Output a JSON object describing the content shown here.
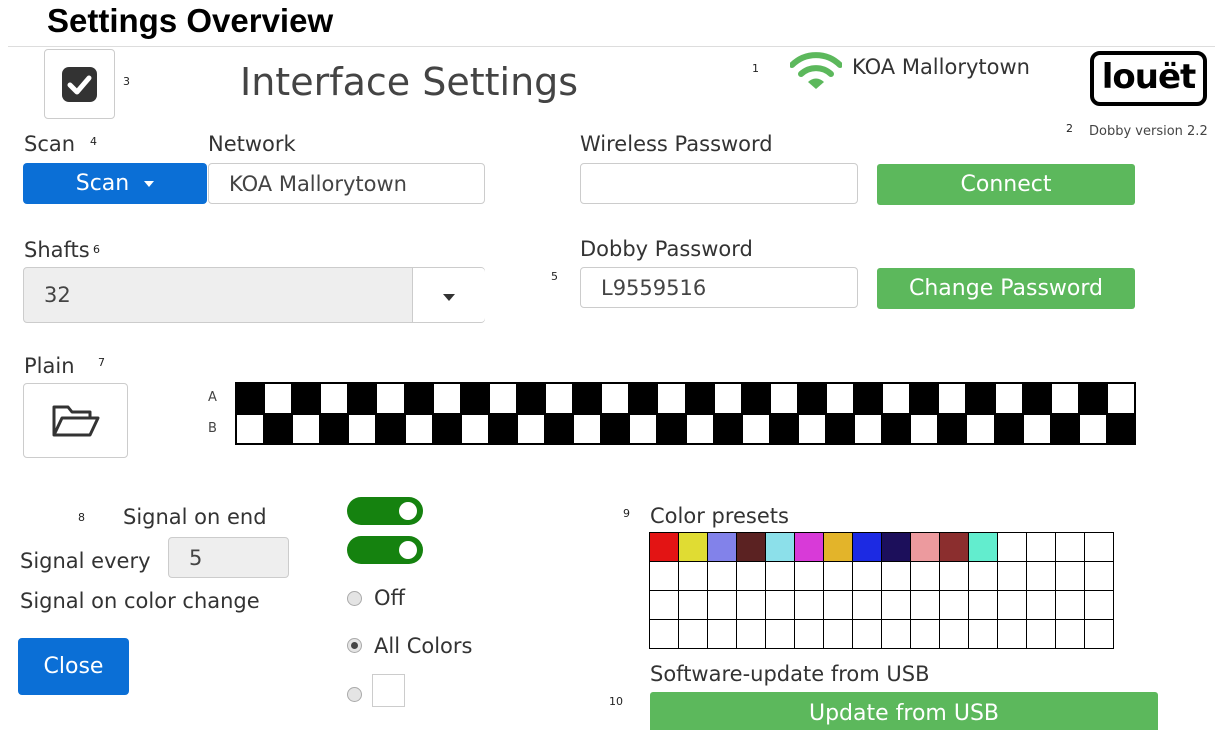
{
  "page": {
    "title": "Settings Overview"
  },
  "header": {
    "checkbox_checked": true,
    "heading": "Interface Settings",
    "network_name": "KOA Mallorytown",
    "brand": "louët",
    "version": "Dobby version 2.2"
  },
  "callouts": {
    "n1": "1",
    "n2": "2",
    "n3": "3",
    "n4": "4",
    "n5": "5",
    "n6": "6",
    "n7": "7",
    "n8": "8",
    "n9": "9",
    "n10": "10"
  },
  "network": {
    "scan_label": "Scan",
    "scan_button": "Scan",
    "network_label": "Network",
    "network_value": "KOA Mallorytown",
    "wireless_label": "Wireless Password",
    "wireless_value": "",
    "connect_button": "Connect"
  },
  "shafts": {
    "label": "Shafts",
    "value": "32"
  },
  "dobby": {
    "label": "Dobby Password",
    "value": "L9559516",
    "change_button": "Change Password"
  },
  "plain": {
    "label": "Plain",
    "row_a": "A",
    "row_b": "B",
    "cells_per_row": 32,
    "row_a_first_black": true
  },
  "signals": {
    "signal_on_end": "Signal on end",
    "signal_every": "Signal every",
    "signal_every_value": "5",
    "signal_on_color_change": "Signal on color change",
    "on_end_enabled": true,
    "every_enabled": true,
    "options": {
      "off": "Off",
      "all": "All Colors"
    },
    "selected_option": "All Colors"
  },
  "close_button": "Close",
  "color_presets": {
    "label": "Color presets",
    "columns": 16,
    "rows": 4,
    "colors": [
      "#e31414",
      "#e0dc33",
      "#8282ea",
      "#5b2222",
      "#8ce0ea",
      "#d83ad8",
      "#e3b42a",
      "#1c2ae3",
      "#1c0f5b",
      "#ec9a9e",
      "#8b2e2e",
      "#62edce"
    ]
  },
  "update": {
    "label": "Software-update from USB",
    "button": "Update from USB"
  }
}
